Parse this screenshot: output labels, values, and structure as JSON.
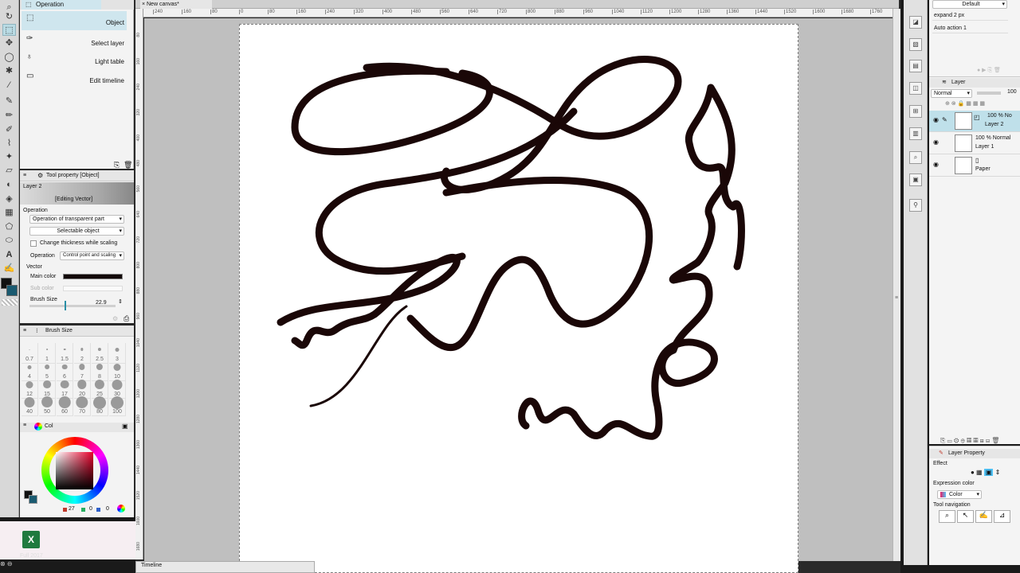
{
  "sub_tool": {
    "tab_label": "Operation",
    "items": [
      {
        "label": "Object",
        "icon": "object-icon"
      },
      {
        "label": "Select layer",
        "icon": "select-layer-icon"
      },
      {
        "label": "Light table",
        "icon": "light-table-icon"
      },
      {
        "label": "Edit timeline",
        "icon": "edit-timeline-icon"
      }
    ]
  },
  "tool_property": {
    "tab_label": "Tool property [Object]",
    "layer_name": "Layer 2",
    "editing_label": "[Editing Vector]",
    "operation_section": "Operation",
    "operation_mode": "Operation of transparent part",
    "selectable_object": "Selectable object",
    "change_thickness_label": "Change thickness while scaling",
    "operation_label": "Operation",
    "operation_value": "Control point and scaling",
    "vector_section": "Vector",
    "main_color_label": "Main color",
    "main_color": "#1a0d0d",
    "sub_color_label": "Sub color",
    "brush_size_label": "Brush Size",
    "brush_size_value": "22.9"
  },
  "brush_size_palette": {
    "tab_label": "Brush Size",
    "sizes": [
      "0.7",
      "1",
      "1.5",
      "2",
      "2.5",
      "3",
      "4",
      "5",
      "6",
      "7",
      "8",
      "10",
      "12",
      "15",
      "17",
      "20",
      "25",
      "30",
      "40",
      "50",
      "60",
      "70",
      "80",
      "100"
    ]
  },
  "color_palette": {
    "tab_label": "Col",
    "values": [
      "27",
      "0",
      "0"
    ]
  },
  "taskbar": {
    "app_label": "Full 2017"
  },
  "canvas": {
    "tab_label": "New canvas*",
    "ruler_ticks": [
      "240",
      "160",
      "80",
      "0",
      "80",
      "160",
      "240",
      "320",
      "400",
      "480",
      "560",
      "640",
      "720",
      "800",
      "880",
      "960",
      "1040",
      "1120",
      "1200",
      "1280",
      "1360",
      "1440",
      "1520",
      "1600",
      "1680",
      "1760"
    ],
    "vruler_ticks": [
      "80",
      "160",
      "240",
      "320",
      "400",
      "480",
      "560",
      "640",
      "720",
      "800",
      "880",
      "960",
      "1040",
      "1120",
      "1200",
      "1280",
      "1360",
      "1440",
      "1520",
      "1600",
      "1680"
    ],
    "stroke_color": "#1a0707"
  },
  "timeline": {
    "label": "Timeline"
  },
  "auto_action": {
    "set_name": "Default",
    "items": [
      "expand 2 px",
      "Auto action 1"
    ]
  },
  "layers": {
    "tab_label": "Layer",
    "blend_mode": "Normal",
    "opacity": "100",
    "rows": [
      {
        "info": "100 % No",
        "name": "Layer 2"
      },
      {
        "info": "100 % Normal",
        "name": "Layer 1"
      },
      {
        "info": "",
        "name": "Paper"
      }
    ]
  },
  "layer_property": {
    "tab_label": "Layer Property",
    "effect_label": "Effect",
    "expression_color_label": "Expression color",
    "expression_color_value": "Color",
    "tool_navigation_label": "Tool navigation"
  },
  "colors": {
    "accent": "#bfe0ea",
    "panel": "#f3f3f3",
    "dark": "#1a1a1a"
  }
}
